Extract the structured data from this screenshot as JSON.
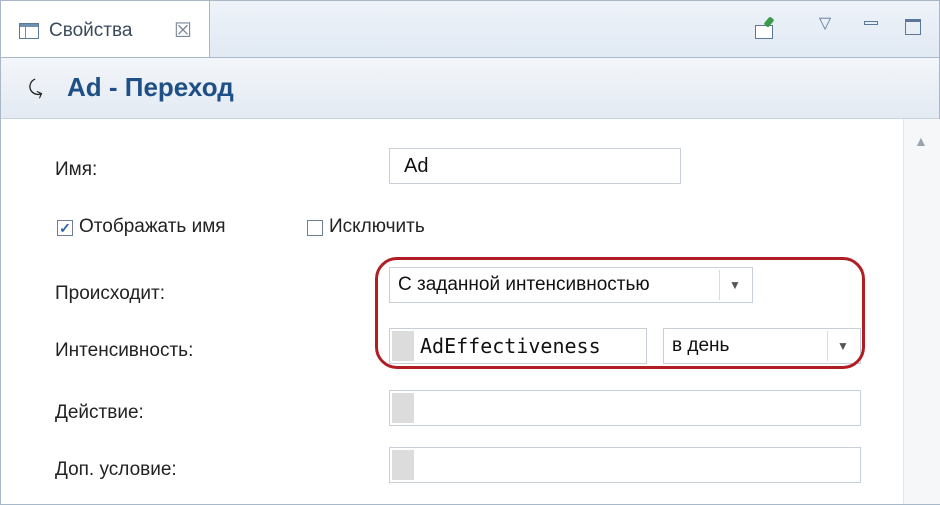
{
  "tab": {
    "label": "Свойства",
    "close_glyph": "☒"
  },
  "view_toolbar": {
    "pin_icon": "pin-editor-icon",
    "menu_glyph": "▽",
    "minimize_glyph": "minimize-icon",
    "maximize_glyph": "maximize-icon"
  },
  "header": {
    "icon_glyph": "⤹",
    "title": "Ad - Переход"
  },
  "form": {
    "name_label": "Имя:",
    "name_value": "Ad",
    "show_name_label": "Отображать имя",
    "show_name_checked": true,
    "exclude_label": "Исключить",
    "exclude_checked": false,
    "occurs_label": "Происходит:",
    "occurs_value": "С заданной интенсивностью",
    "rate_label": "Интенсивность:",
    "rate_value": "AdEffectiveness",
    "rate_unit": "в день",
    "action_label": "Действие:",
    "action_value": "",
    "guard_label": "Доп. условие:",
    "guard_value": ""
  },
  "colors": {
    "title": "#1f4f87",
    "highlight": "#b01e24",
    "border": "#a9b8c8"
  }
}
